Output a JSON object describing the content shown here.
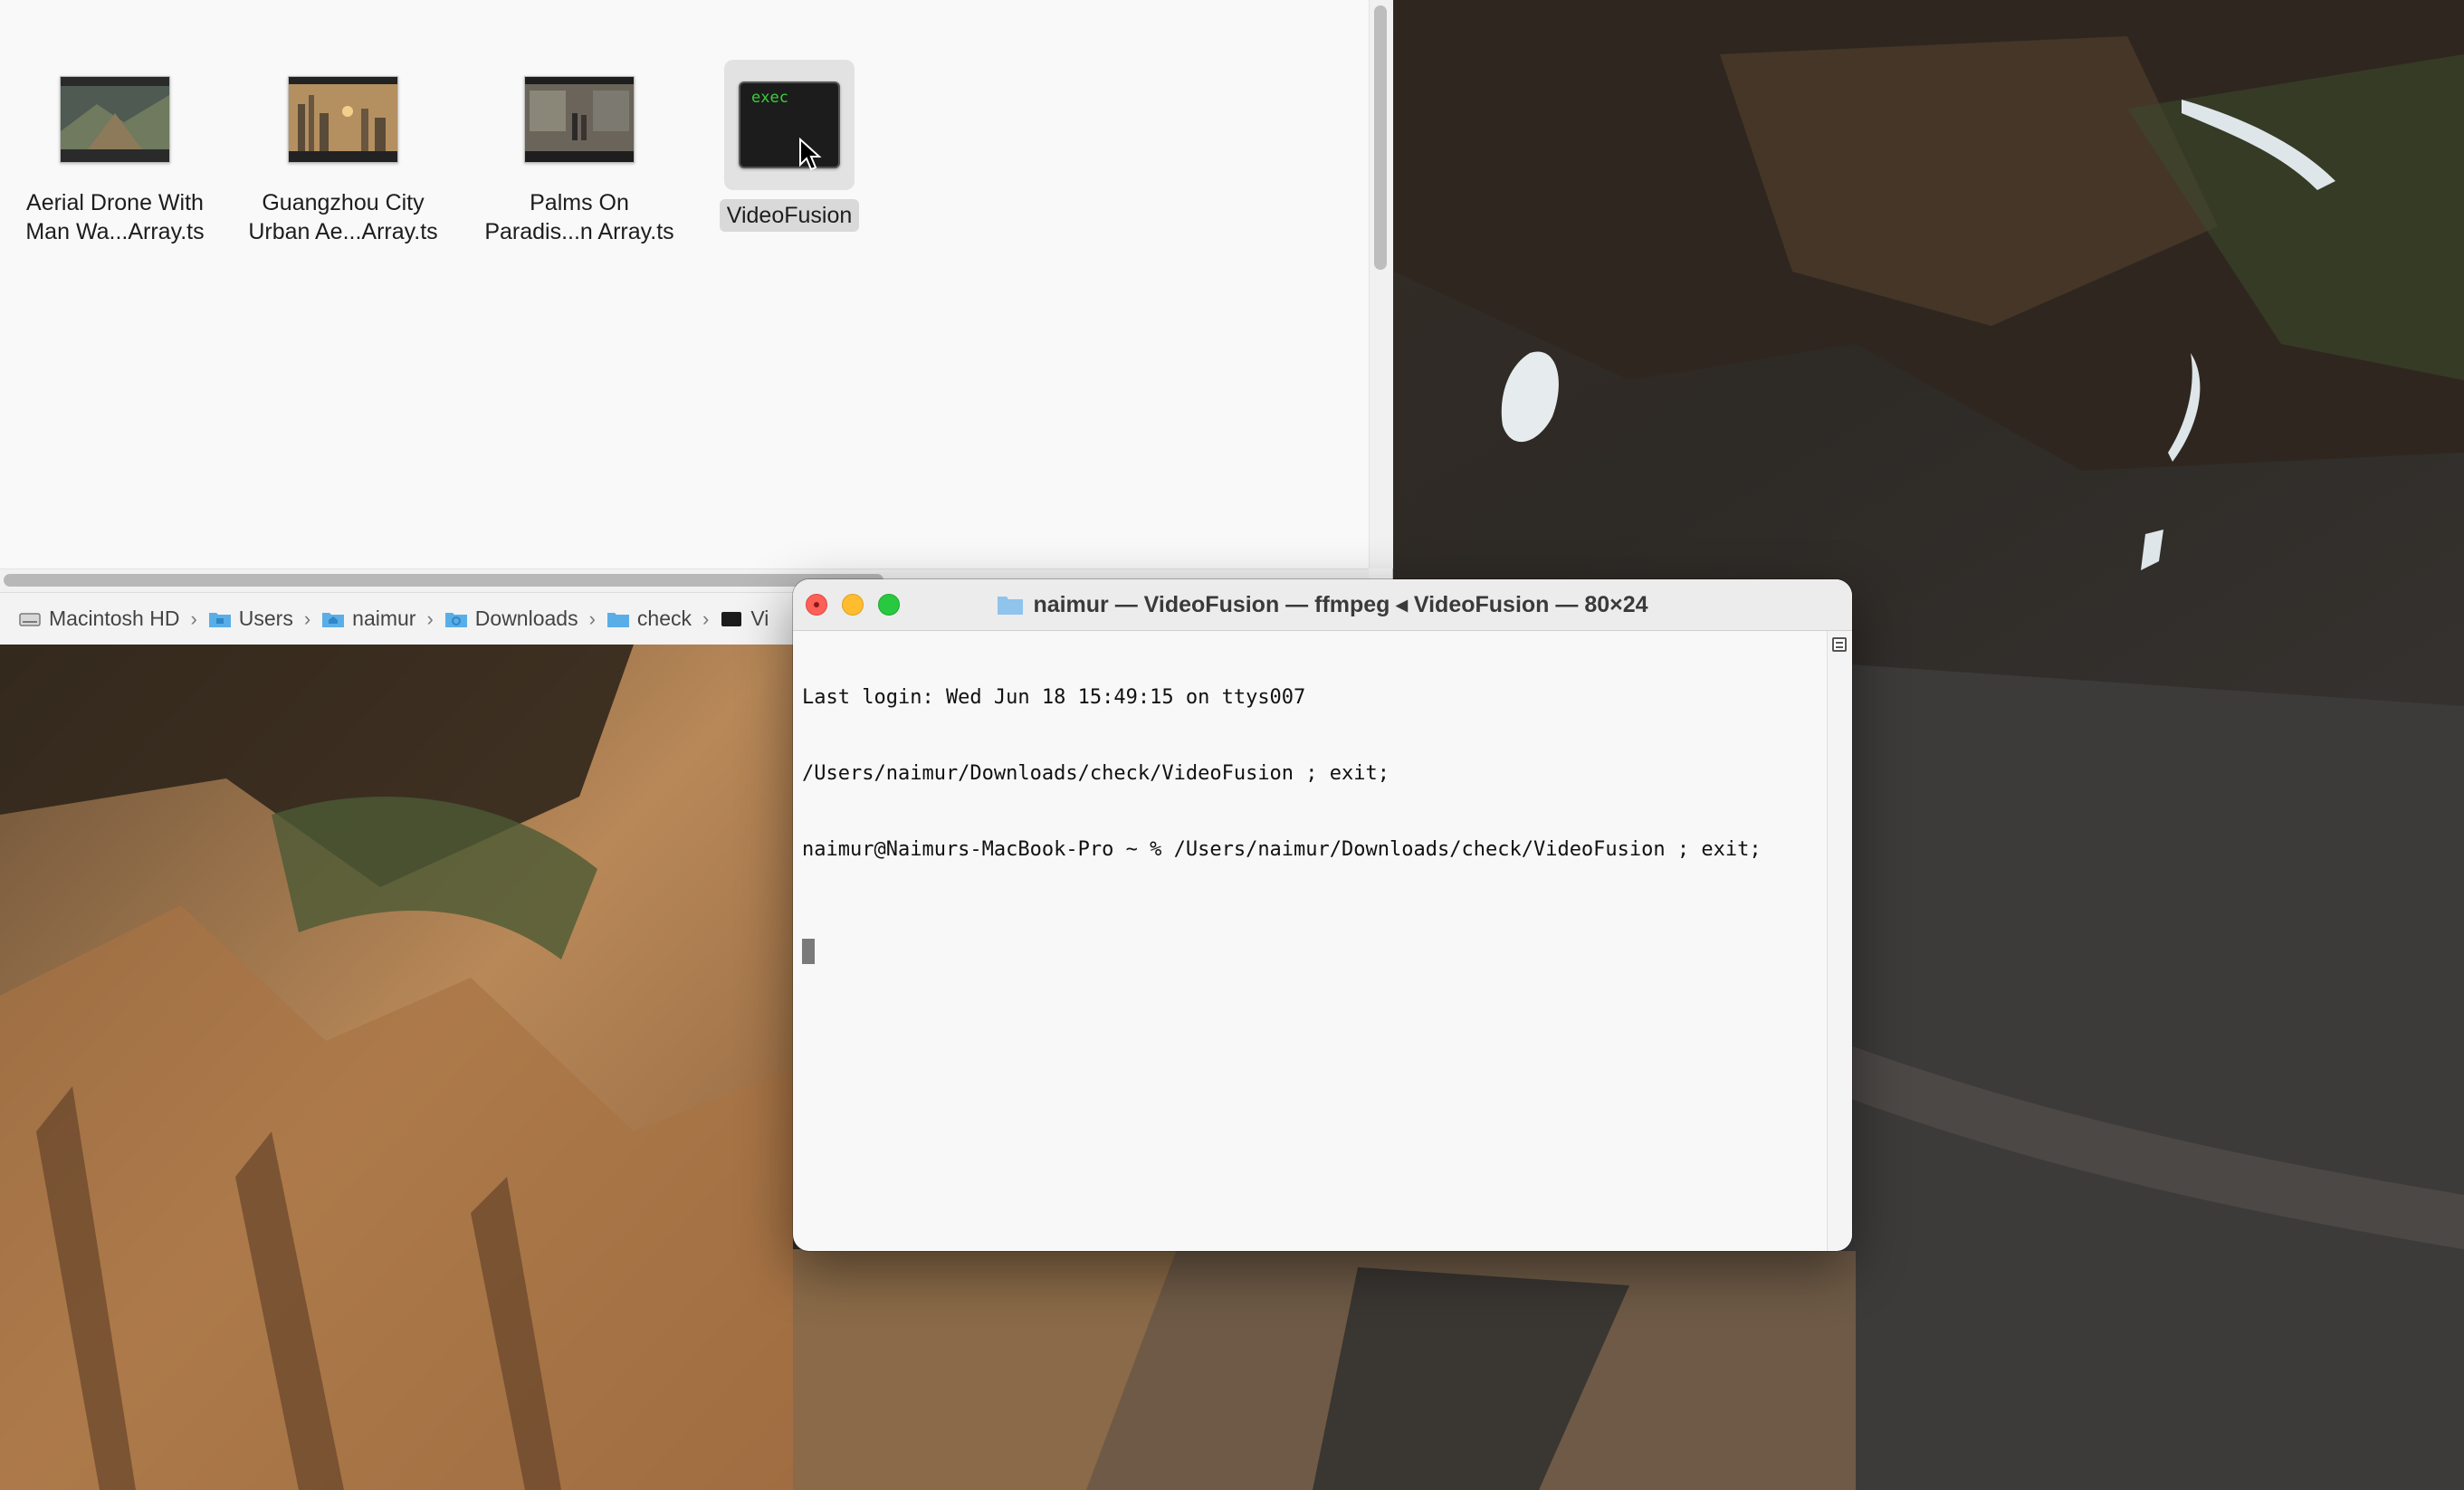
{
  "finder": {
    "files": [
      {
        "name": "Aerial Drone With\nMan Wa...Array.ts",
        "icon": "video-thumbnail-aerial-drone"
      },
      {
        "name": "Guangzhou City\nUrban Ae...Array.ts",
        "icon": "video-thumbnail-city-skyline"
      },
      {
        "name": "Palms On\nParadis...n Array.ts",
        "icon": "video-thumbnail-room-scene"
      },
      {
        "name": "VideoFusion",
        "icon": "exec-icon",
        "thumb_text": "exec",
        "selected": true
      }
    ],
    "path_bar": [
      {
        "label": "Macintosh HD",
        "icon": "hard-drive-icon"
      },
      {
        "label": "Users",
        "icon": "folder-icon"
      },
      {
        "label": "naimur",
        "icon": "home-folder-icon"
      },
      {
        "label": "Downloads",
        "icon": "downloads-folder-icon"
      },
      {
        "label": "check",
        "icon": "folder-icon"
      },
      {
        "label": "Vi",
        "icon": "exec-icon"
      }
    ],
    "separator": "›"
  },
  "terminal": {
    "title": "naimur — VideoFusion — ffmpeg ◂ VideoFusion — 80×24",
    "lines": [
      "Last login: Wed Jun 18 15:49:15 on ttys007",
      "/Users/naimur/Downloads/check/VideoFusion ; exit;",
      "naimur@Naimurs-MacBook-Pro ~ % /Users/naimur/Downloads/check/VideoFusion ; exit;"
    ]
  },
  "colors": {
    "close": "#fe5f57",
    "minimize": "#febc2e",
    "maximize": "#28c840",
    "folder_blue": "#5aaee8"
  }
}
